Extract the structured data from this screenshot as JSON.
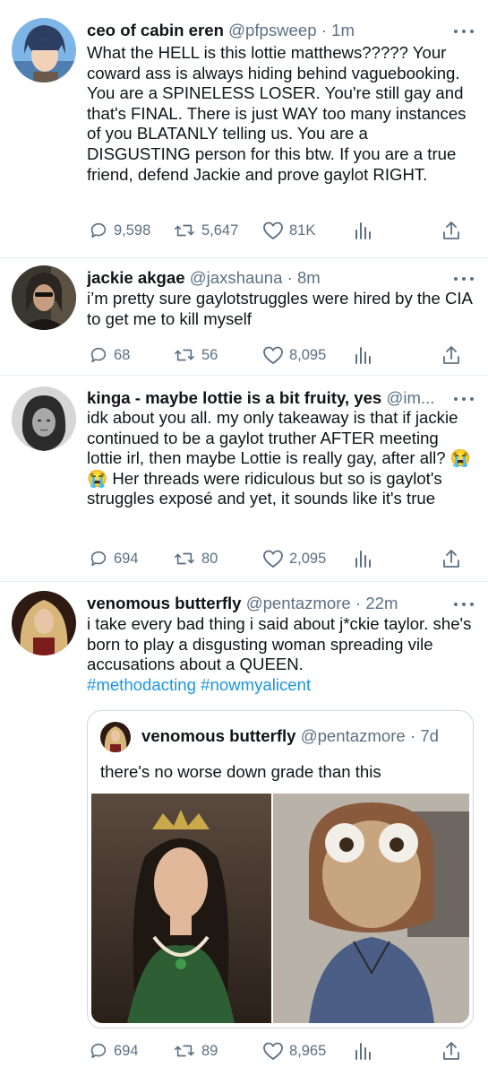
{
  "tweets": [
    {
      "name": "ceo of cabin eren",
      "handle": "@pfpsweep",
      "dot": " · ",
      "time": "1m",
      "text": "What the HELL is this lottie matthews????? Your coward ass is always hiding behind vaguebooking. You are a SPINELESS LOSER. You're still gay and that's FINAL. There is just WAY too many instances of you BLATANLY telling us. You are a DISGUSTING person for this btw. If you are a true friend, defend Jackie and prove gaylot RIGHT.",
      "replies": "9,598",
      "retweets": "5,647",
      "likes": "81K"
    },
    {
      "name": "jackie akgae",
      "handle": "@jaxshauna",
      "dot": " · ",
      "time": "8m",
      "text": "i’m pretty sure gaylotstruggles were hired by the CIA to get me to kill myself",
      "replies": "68",
      "retweets": "56",
      "likes": "8,095"
    },
    {
      "name": "kinga - maybe lottie is a bit fruity, yes",
      "handle": "@im...",
      "dot": "",
      "time": "",
      "text": "idk about you all. my only takeaway is that if jackie continued to be a gaylot truther AFTER meeting lottie irl, then maybe Lottie is really gay, after all? 😭😭 Her threads were ridiculous but so is gaylot's struggles exposé and yet, it sounds like it's true",
      "replies": "694",
      "retweets": "80",
      "likes": "2,095"
    },
    {
      "name": "venomous butterfly",
      "handle": "@pentazmore",
      "dot": " · ",
      "time": "22m",
      "text": "i take every bad thing i said about j*ckie taylor. she's born to play a disgusting woman spreading vile accusations about a QUEEN.",
      "hashtags": "#methodacting #nowmyalicent",
      "replies": "694",
      "retweets": "89",
      "likes": "8,965",
      "quote": {
        "name": "venomous butterfly",
        "handle": "@pentazmore",
        "dot": " · ",
        "time": "7d",
        "text": "there's no worse down grade than this"
      }
    }
  ],
  "colors": {
    "text": "#0f1419",
    "muted": "#5b7083",
    "link": "#1b95e0",
    "divider": "#e6ecf0"
  },
  "icons": [
    "reply-icon",
    "retweet-icon",
    "like-icon",
    "analytics-icon",
    "share-icon",
    "more-icon"
  ]
}
